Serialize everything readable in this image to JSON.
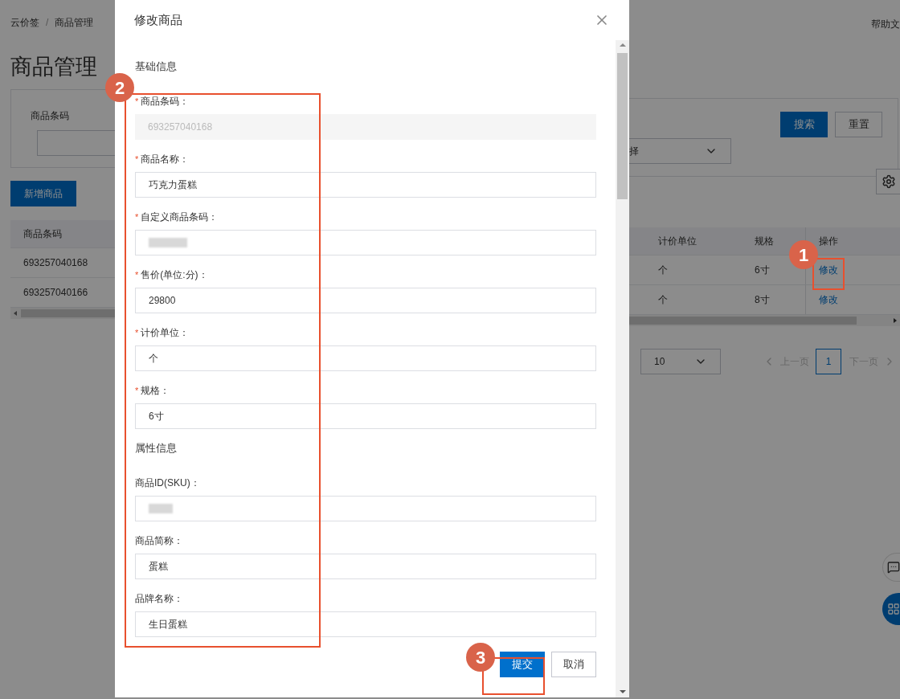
{
  "page": {
    "breadcrumb": [
      "云价签",
      "/",
      "商品管理"
    ],
    "title": "商品管理",
    "help_link": "帮助文",
    "filter": {
      "label": "商品条码",
      "select_value": "择",
      "buttons": [
        {
          "label": "搜索",
          "kind": "primary"
        },
        {
          "label": "重置",
          "kind": "default"
        }
      ]
    },
    "add_button": "新增商品",
    "table": {
      "left_columns": [
        "商品条码"
      ],
      "right_columns": [
        "计价单位",
        "规格",
        "操作"
      ],
      "rows": [
        {
          "barcode": "693257040168",
          "unit": "个",
          "spec": "6寸",
          "action": "修改"
        },
        {
          "barcode": "693257040166",
          "unit": "个",
          "spec": "8寸",
          "action": "修改"
        }
      ]
    },
    "pagination": {
      "page_size": "10",
      "prev": "上一页",
      "pages": [
        {
          "label": "1",
          "selected": true
        }
      ],
      "next": "下一页"
    }
  },
  "modal": {
    "title": "修改商品",
    "sections": [
      {
        "title": "基础信息",
        "fields": [
          {
            "label": "商品条码：",
            "required_mark": "*",
            "disabled": true,
            "masked": false,
            "value": "693257040168"
          },
          {
            "label": "商品名称：",
            "required_mark": "*",
            "disabled": false,
            "masked": false,
            "value": "巧克力蛋糕"
          },
          {
            "label": "自定义商品条码：",
            "required_mark": "*",
            "disabled": false,
            "masked": true
          },
          {
            "label": "售价(单位:分)：",
            "required_mark": "*",
            "disabled": false,
            "masked": false,
            "value": "29800"
          },
          {
            "label": "计价单位：",
            "required_mark": "*",
            "disabled": false,
            "masked": false,
            "value": "个"
          },
          {
            "label": "规格：",
            "required_mark": "*",
            "disabled": false,
            "masked": false,
            "value": "6寸"
          }
        ]
      },
      {
        "title": "属性信息",
        "fields": [
          {
            "label": "商品ID(SKU)：",
            "disabled": false,
            "masked": true
          },
          {
            "label": "商品简称：",
            "disabled": false,
            "masked": false,
            "value": "蛋糕"
          },
          {
            "label": "品牌名称：",
            "disabled": false,
            "masked": false,
            "value": "生日蛋糕"
          }
        ]
      }
    ],
    "buttons": [
      {
        "label": "提交",
        "kind": "primary"
      },
      {
        "label": "取消",
        "kind": "default"
      }
    ]
  },
  "annotations": [
    {
      "number": "1"
    },
    {
      "number": "2"
    },
    {
      "number": "3"
    }
  ]
}
